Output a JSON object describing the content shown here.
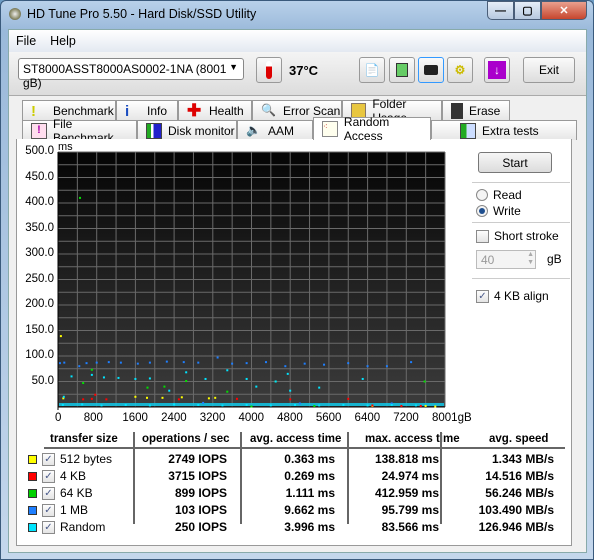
{
  "window": {
    "title": "HD Tune Pro 5.50 - Hard Disk/SSD Utility",
    "min": "—",
    "max": "▢",
    "close": "✕"
  },
  "menu": [
    {
      "label": "File"
    },
    {
      "label": "Help"
    }
  ],
  "toolbar": {
    "drive": "ST8000ASST8000AS0002-1NA (8001 gB)",
    "temperature": "37°C",
    "exit": "Exit"
  },
  "tabs_row1": [
    "Benchmark",
    "Info",
    "Health",
    "Error Scan",
    "Folder Usage",
    "Erase"
  ],
  "tabs_row2": [
    "File Benchmark",
    "Disk monitor",
    "AAM",
    "Random Access",
    "Extra tests"
  ],
  "active_tab": "Random Access",
  "side": {
    "start": "Start",
    "read": "Read",
    "write": "Write",
    "mode": "Write",
    "short_stroke": "Short stroke",
    "short_stroke_checked": false,
    "stroke_value": "40",
    "stroke_unit": "gB",
    "align": "4 KB align",
    "align_checked": true
  },
  "chart_data": {
    "type": "scatter",
    "yunit": "ms",
    "xunit": "gB",
    "xlim": [
      0,
      8001
    ],
    "ylim": [
      0,
      500
    ],
    "grid": true,
    "yticks": [
      "500.0",
      "450.0",
      "400.0",
      "350.0",
      "300.0",
      "250.0",
      "200.0",
      "150.0",
      "100.0",
      "50.0"
    ],
    "xticks": [
      "0",
      "800",
      "1600",
      "2400",
      "3200",
      "4000",
      "4800",
      "5600",
      "6400",
      "7200",
      "8001gB"
    ],
    "series": [
      {
        "name": "512 bytes",
        "color": "#ffff00",
        "points": [
          [
            60,
            139
          ],
          [
            110,
            17
          ],
          [
            1600,
            20
          ],
          [
            1840,
            18
          ],
          [
            2160,
            18
          ],
          [
            2560,
            19
          ],
          [
            3120,
            17
          ],
          [
            3250,
            18
          ],
          [
            6500,
            2
          ],
          [
            7600,
            2
          ],
          [
            7800,
            1
          ]
        ]
      },
      {
        "name": "4 KB",
        "color": "#ff0000",
        "points": [
          [
            520,
            15
          ],
          [
            700,
            16
          ],
          [
            770,
            24
          ],
          [
            1000,
            15
          ],
          [
            2500,
            15
          ],
          [
            3700,
            16
          ],
          [
            4800,
            15
          ],
          [
            6000,
            16
          ],
          [
            6500,
            3
          ],
          [
            7100,
            2
          ],
          [
            7500,
            2
          ]
        ]
      },
      {
        "name": "64 KB",
        "color": "#00e000",
        "points": [
          [
            455,
            410
          ],
          [
            520,
            47
          ],
          [
            700,
            73
          ],
          [
            1850,
            38
          ],
          [
            2200,
            40
          ],
          [
            2650,
            51
          ],
          [
            3500,
            30
          ],
          [
            4500,
            50
          ],
          [
            7580,
            50
          ],
          [
            4000,
            1
          ],
          [
            5300,
            2
          ]
        ]
      },
      {
        "name": "1 MB",
        "color": "#1e7fff",
        "points": [
          [
            40,
            86
          ],
          [
            130,
            87
          ],
          [
            440,
            80
          ],
          [
            590,
            86
          ],
          [
            800,
            87
          ],
          [
            1050,
            88
          ],
          [
            1300,
            87
          ],
          [
            1650,
            85
          ],
          [
            1900,
            87
          ],
          [
            2250,
            89
          ],
          [
            2600,
            88
          ],
          [
            2900,
            87
          ],
          [
            3300,
            97
          ],
          [
            3600,
            85
          ],
          [
            3900,
            86
          ],
          [
            4300,
            88
          ],
          [
            4700,
            80
          ],
          [
            5100,
            85
          ],
          [
            5500,
            83
          ],
          [
            6000,
            86
          ],
          [
            6400,
            80
          ],
          [
            6800,
            80
          ],
          [
            7300,
            88
          ],
          [
            3000,
            8
          ],
          [
            5000,
            7
          ],
          [
            6900,
            7
          ]
        ]
      },
      {
        "name": "Random",
        "color": "#00e5ff",
        "points": [
          [
            120,
            20
          ],
          [
            280,
            60
          ],
          [
            700,
            63
          ],
          [
            950,
            58
          ],
          [
            1250,
            57
          ],
          [
            1600,
            55
          ],
          [
            1900,
            56
          ],
          [
            2300,
            32
          ],
          [
            2650,
            68
          ],
          [
            3050,
            55
          ],
          [
            3500,
            72
          ],
          [
            3900,
            55
          ],
          [
            4100,
            40
          ],
          [
            4500,
            50
          ],
          [
            4750,
            65
          ],
          [
            4800,
            32
          ],
          [
            5400,
            38
          ],
          [
            6300,
            55
          ],
          [
            100,
            4
          ],
          [
            500,
            5
          ],
          [
            900,
            3
          ],
          [
            1400,
            4
          ],
          [
            1900,
            3
          ],
          [
            2400,
            5
          ],
          [
            2900,
            4
          ],
          [
            3400,
            3
          ],
          [
            3900,
            4
          ],
          [
            4400,
            3
          ],
          [
            4900,
            4
          ],
          [
            5400,
            3
          ],
          [
            5900,
            4
          ],
          [
            6400,
            3
          ],
          [
            6900,
            4
          ],
          [
            7400,
            3
          ]
        ]
      }
    ]
  },
  "table": {
    "headers": [
      "transfer size",
      "operations / sec",
      "avg. access time",
      "max. access time",
      "avg. speed"
    ],
    "rows": [
      {
        "color": "#ffff00",
        "label": "512 bytes",
        "ops": "2749 IOPS",
        "avg": "0.363 ms",
        "max": "138.818 ms",
        "speed": "1.343 MB/s"
      },
      {
        "color": "#ff0000",
        "label": "4 KB",
        "ops": "3715 IOPS",
        "avg": "0.269 ms",
        "max": "24.974 ms",
        "speed": "14.516 MB/s"
      },
      {
        "color": "#00d000",
        "label": "64 KB",
        "ops": "899 IOPS",
        "avg": "1.111 ms",
        "max": "412.959 ms",
        "speed": "56.246 MB/s"
      },
      {
        "color": "#1e7fff",
        "label": "1 MB",
        "ops": "103 IOPS",
        "avg": "9.662 ms",
        "max": "95.799 ms",
        "speed": "103.490 MB/s"
      },
      {
        "color": "#00e5ff",
        "label": "Random",
        "ops": "250 IOPS",
        "avg": "3.996 ms",
        "max": "83.566 ms",
        "speed": "126.946 MB/s"
      }
    ]
  }
}
